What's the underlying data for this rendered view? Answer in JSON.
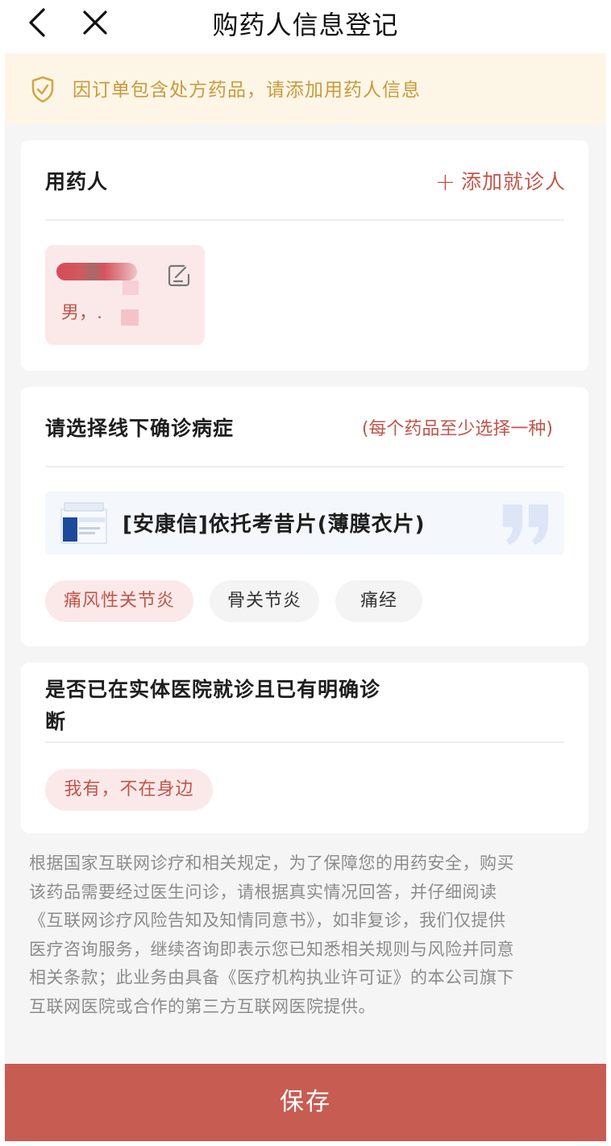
{
  "header": {
    "title": "购药人信息登记"
  },
  "notice": {
    "text": "因订单包含处方药品，请添加用药人信息"
  },
  "patient_section": {
    "title": "用药人",
    "add_label": "添加就诊人",
    "patient": {
      "gender_text": "男，."
    }
  },
  "diagnosis_section": {
    "title": "请选择线下确诊病症",
    "note": "(每个药品至少选择一种)",
    "drug_name": "[安康信]依托考昔片(薄膜衣片)",
    "options": [
      {
        "label": "痛风性关节炎",
        "selected": true
      },
      {
        "label": "骨关节炎",
        "selected": false
      },
      {
        "label": "痛经",
        "selected": false
      }
    ]
  },
  "visit_section": {
    "title": "是否已在实体医院就诊且已有明确诊断",
    "answer": "我有，不在身边"
  },
  "disclaimer": {
    "lines": [
      "根据国家互联网诊疗和相关规定，为了保障您的用药安全，购买",
      "该药品需要经过医生问诊，请根据真实情况回答，并仔细阅读",
      "《互联网诊疗风险告知及知情同意书》，如非复诊，我们仅提供",
      "医疗咨询服务，继续咨询即表示您已知悉相关规则与风险并同意",
      "相关条款；此业务由具备《医疗机构执业许可证》的本公司旗下",
      "互联网医院或合作的第三方互联网医院提供。"
    ]
  },
  "footer": {
    "save_label": "保存"
  },
  "colors": {
    "accent": "#c25549",
    "save_button": "#c75c52",
    "notice_bg": "#fdf6e7",
    "notice_text": "#c99a3c"
  },
  "icons": [
    "back-arrow-icon",
    "close-icon",
    "shield-check-icon",
    "plus-icon",
    "edit-icon",
    "drug-image",
    "quote-icon"
  ]
}
